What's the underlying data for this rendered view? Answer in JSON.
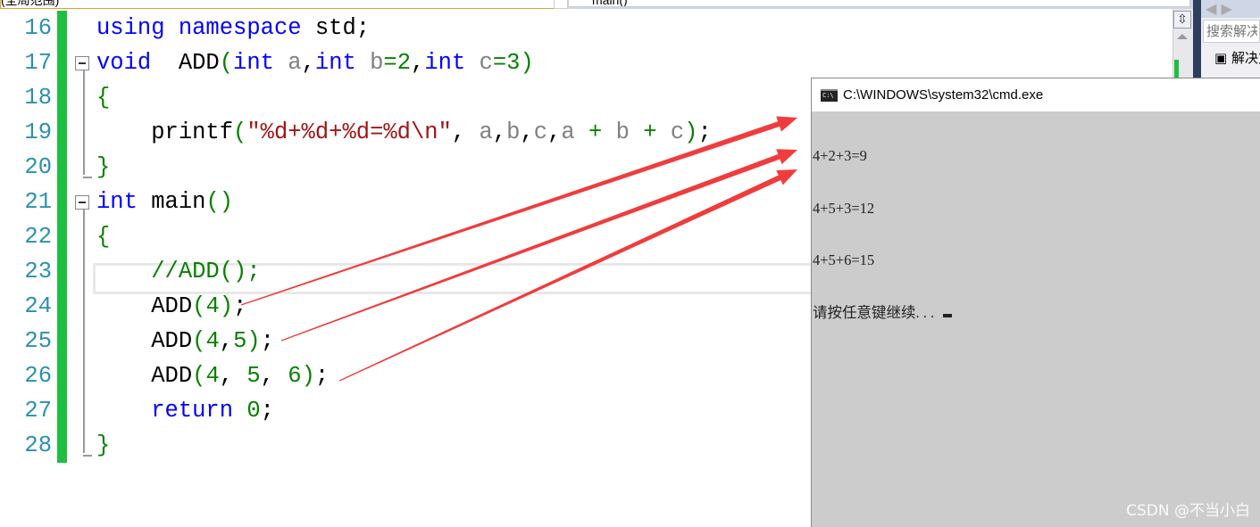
{
  "nav": {
    "scope_label": "(全局范围)",
    "function_label": "main()"
  },
  "editor": {
    "lines": [
      {
        "n": "16",
        "fold": false,
        "tokens": [
          {
            "t": "using",
            "k": "kw"
          },
          {
            "t": " "
          },
          {
            "t": "namespace",
            "k": "kw"
          },
          {
            "t": " std;",
            "k": "id"
          }
        ]
      },
      {
        "n": "17",
        "fold": true,
        "tokens": [
          {
            "t": "void",
            "k": "kw"
          },
          {
            "t": "  ADD",
            "k": "id"
          },
          {
            "t": "(",
            "k": "br"
          },
          {
            "t": "int",
            "k": "kw"
          },
          {
            "t": " a",
            "k": "pm"
          },
          {
            "t": ",",
            "k": "id"
          },
          {
            "t": "int",
            "k": "kw"
          },
          {
            "t": " b",
            "k": "pm"
          },
          {
            "t": "=2",
            "k": "num"
          },
          {
            "t": ",",
            "k": "id"
          },
          {
            "t": "int",
            "k": "kw"
          },
          {
            "t": " c",
            "k": "pm"
          },
          {
            "t": "=3",
            "k": "num"
          },
          {
            "t": ")",
            "k": "br"
          }
        ]
      },
      {
        "n": "18",
        "fold": false,
        "tokens": [
          {
            "t": "{",
            "k": "br"
          }
        ]
      },
      {
        "n": "19",
        "fold": false,
        "tokens": [
          {
            "t": "    printf",
            "k": "id"
          },
          {
            "t": "(",
            "k": "br"
          },
          {
            "t": "\"%d+%d+%d=%d\\n\"",
            "k": "str"
          },
          {
            "t": ", ",
            "k": "id"
          },
          {
            "t": "a",
            "k": "pm"
          },
          {
            "t": ",",
            "k": "id"
          },
          {
            "t": "b",
            "k": "pm"
          },
          {
            "t": ",",
            "k": "id"
          },
          {
            "t": "c",
            "k": "pm"
          },
          {
            "t": ",",
            "k": "id"
          },
          {
            "t": "a",
            "k": "pm"
          },
          {
            "t": " + ",
            "k": "op"
          },
          {
            "t": "b",
            "k": "pm"
          },
          {
            "t": " + ",
            "k": "op"
          },
          {
            "t": "c",
            "k": "pm"
          },
          {
            "t": ")",
            "k": "br"
          },
          {
            "t": ";",
            "k": "id"
          }
        ]
      },
      {
        "n": "20",
        "fold": false,
        "tokens": [
          {
            "t": "}",
            "k": "br"
          }
        ]
      },
      {
        "n": "21",
        "fold": true,
        "tokens": [
          {
            "t": "int",
            "k": "kw"
          },
          {
            "t": " main",
            "k": "id"
          },
          {
            "t": "()",
            "k": "br"
          }
        ]
      },
      {
        "n": "22",
        "fold": false,
        "tokens": [
          {
            "t": "{",
            "k": "br"
          }
        ]
      },
      {
        "n": "23",
        "fold": false,
        "tokens": [
          {
            "t": "    //ADD();",
            "k": "cm"
          }
        ]
      },
      {
        "n": "24",
        "fold": false,
        "tokens": [
          {
            "t": "    ADD",
            "k": "id"
          },
          {
            "t": "(",
            "k": "br"
          },
          {
            "t": "4",
            "k": "num"
          },
          {
            "t": ")",
            "k": "br"
          },
          {
            "t": ";",
            "k": "id"
          }
        ]
      },
      {
        "n": "25",
        "fold": false,
        "tokens": [
          {
            "t": "    ADD",
            "k": "id"
          },
          {
            "t": "(",
            "k": "br"
          },
          {
            "t": "4",
            "k": "num"
          },
          {
            "t": ",",
            "k": "id"
          },
          {
            "t": "5",
            "k": "num"
          },
          {
            "t": ")",
            "k": "br"
          },
          {
            "t": ";",
            "k": "id"
          }
        ]
      },
      {
        "n": "26",
        "fold": false,
        "tokens": [
          {
            "t": "    ADD",
            "k": "id"
          },
          {
            "t": "(",
            "k": "br"
          },
          {
            "t": "4",
            "k": "num"
          },
          {
            "t": ", ",
            "k": "id"
          },
          {
            "t": "5",
            "k": "num"
          },
          {
            "t": ", ",
            "k": "id"
          },
          {
            "t": "6",
            "k": "num"
          },
          {
            "t": ")",
            "k": "br"
          },
          {
            "t": ";",
            "k": "id"
          }
        ]
      },
      {
        "n": "27",
        "fold": false,
        "tokens": [
          {
            "t": "    return",
            "k": "kw"
          },
          {
            "t": " 0",
            "k": "num"
          },
          {
            "t": ";",
            "k": "id"
          }
        ]
      },
      {
        "n": "28",
        "fold": false,
        "tokens": [
          {
            "t": "}",
            "k": "br"
          }
        ]
      }
    ]
  },
  "solution_panel": {
    "search_placeholder": "搜索解决方案资源管理器",
    "item_label": "解决方案"
  },
  "console": {
    "title": "C:\\WINDOWS\\system32\\cmd.exe",
    "icon": "C:\\",
    "output": [
      "4+2+3=9",
      "4+5+3=12",
      "4+5+6=15",
      "请按任意键继续. . . "
    ]
  },
  "annotation": {
    "arrow_color": "#f03c3c"
  },
  "watermark": "CSDN @不当小白"
}
